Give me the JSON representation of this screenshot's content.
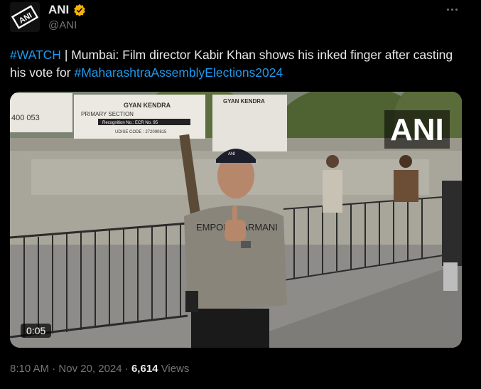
{
  "author": {
    "name": "ANI",
    "handle": "@ANI",
    "avatar_text": "ANI",
    "verified_color": "#f4b400"
  },
  "tweet": {
    "parts": [
      {
        "text": "#WATCH",
        "type": "hashtag"
      },
      {
        "text": " | Mumbai: Film director Kabir Khan shows his inked finger after casting his vote for ",
        "type": "text"
      },
      {
        "text": "#MaharashtraAssemblyElections2024",
        "type": "hashtag"
      }
    ]
  },
  "media": {
    "duration": "0:05",
    "watermark": "ANI",
    "signage": {
      "sign_number": "400 053",
      "school_name": "GYAN KENDRA",
      "school_section": "PRIMARY SECTION",
      "recognition": "Recognition No.: ECR No. 95",
      "udise": "UDISE CODE : 272090815",
      "sign_right_title": "GYAN KENDRA"
    },
    "cap_text": "ANI",
    "shirt_text": "EMPORIO ARMANI"
  },
  "meta": {
    "time": "8:10 AM",
    "separator": "·",
    "date": "Nov 20, 2024",
    "views_count": "6,614",
    "views_label": "Views"
  },
  "colors": {
    "background": "#000000",
    "text": "#e7e9ea",
    "secondary": "#71767b",
    "link": "#1d9bf0"
  },
  "icons": [
    "verified-badge-icon",
    "more-options-icon",
    "ani-logo-icon"
  ]
}
